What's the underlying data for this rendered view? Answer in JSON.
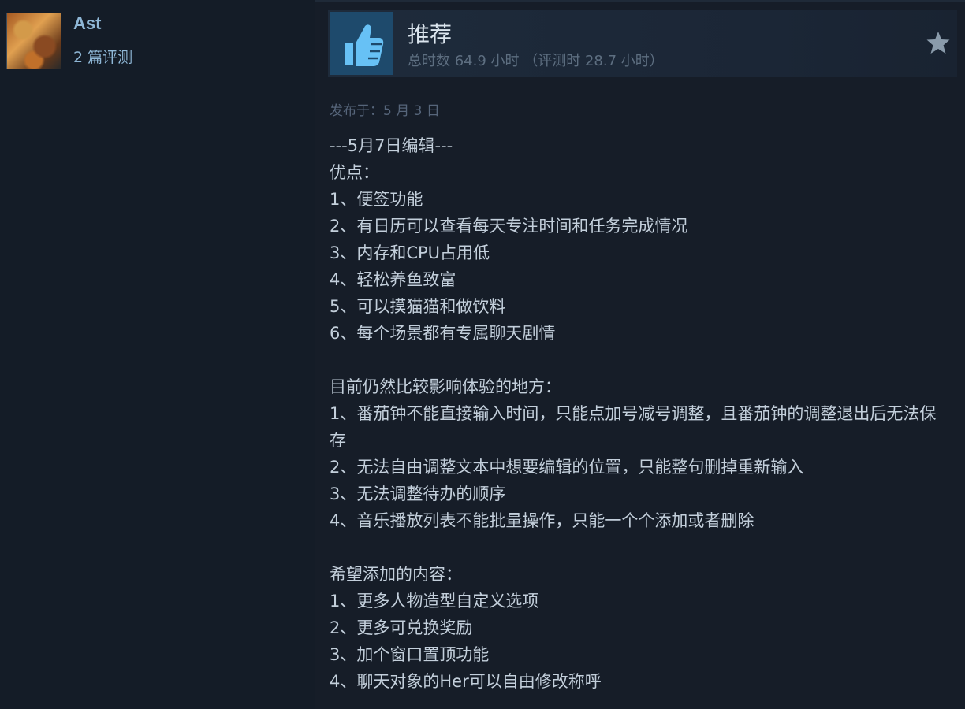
{
  "user": {
    "name": "Ast",
    "review_count": "2 篇评测"
  },
  "review": {
    "verdict": "推荐",
    "hours": "总时数 64.9 小时  （评测时 28.7 小时）",
    "posted": "发布于：5 月 3 日",
    "lines": {
      "l1": "---5月7日编辑---",
      "l2": "优点：",
      "l3": "1、便签功能",
      "l4": "2、有日历可以查看每天专注时间和任务完成情况",
      "l5": "3、内存和CPU占用低",
      "l6": "4、轻松养鱼致富",
      "l7": "5、可以摸猫猫和做饮料",
      "l8": "6、每个场景都有专属聊天剧情",
      "l9": "目前仍然比较影响体验的地方：",
      "l10": "1、番茄钟不能直接输入时间，只能点加号减号调整，且番茄钟的调整退出后无法保存",
      "l11": "2、无法自由调整文本中想要编辑的位置，只能整句删掉重新输入",
      "l12": "3、无法调整待办的顺序",
      "l13": "4、音乐播放列表不能批量操作，只能一个个添加或者删除",
      "l14": "希望添加的内容：",
      "l15": "1、更多人物造型自定义选项",
      "l16": "2、更多可兑换奖励",
      "l17": "3、加个窗口置顶功能",
      "l18": "4、聊天对象的Her可以自由修改称呼"
    }
  },
  "icons": {
    "verdict": "thumbs-up-icon",
    "award": "star-icon"
  },
  "colors": {
    "background": "#161d28",
    "link": "#8fb7d6",
    "thumb_bg": "#1e4a6c",
    "thumb": "#67c1f5"
  }
}
